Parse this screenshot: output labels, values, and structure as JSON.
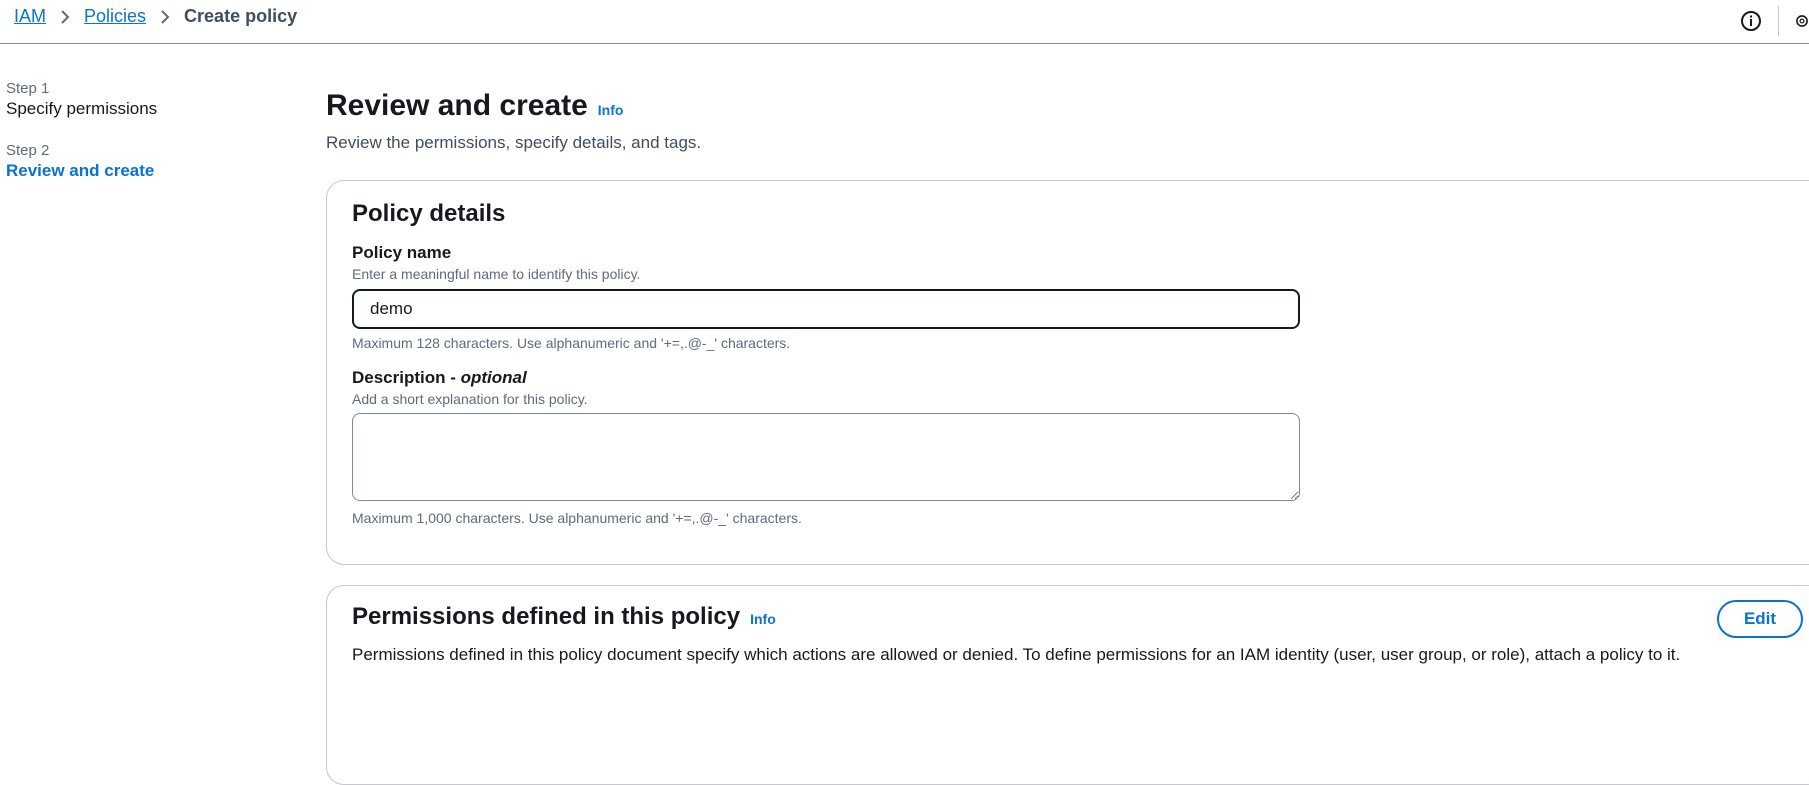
{
  "breadcrumb": {
    "items": [
      "IAM",
      "Policies"
    ],
    "current": "Create policy"
  },
  "top_icons": [
    "info-icon",
    "settings-icon"
  ],
  "steps": [
    {
      "label": "Step 1",
      "title": "Specify permissions",
      "active": false
    },
    {
      "label": "Step 2",
      "title": "Review and create",
      "active": true
    }
  ],
  "page": {
    "title": "Review and create",
    "info": "Info",
    "subtitle": "Review the permissions, specify details, and tags."
  },
  "policy_details": {
    "title": "Policy details",
    "name": {
      "label": "Policy name",
      "description": "Enter a meaningful name to identify this policy.",
      "value": "demo",
      "hint": "Maximum 128 characters. Use alphanumeric and '+=,.@-_' characters."
    },
    "description": {
      "label": "Description - ",
      "label_optional": "optional",
      "description": "Add a short explanation for this policy.",
      "value": "",
      "hint": "Maximum 1,000 characters. Use alphanumeric and '+=,.@-_' characters."
    }
  },
  "permissions": {
    "title": "Permissions defined in this policy",
    "info": "Info",
    "edit_label": "Edit",
    "text": "Permissions defined in this policy document specify which actions are allowed or denied. To define permissions for an IAM identity (user, user group, or role), attach a policy to it."
  },
  "colors": {
    "link": "#0972d3",
    "text": "#16191f",
    "muted": "#5f6b7a",
    "border": "#c6c6cd"
  }
}
